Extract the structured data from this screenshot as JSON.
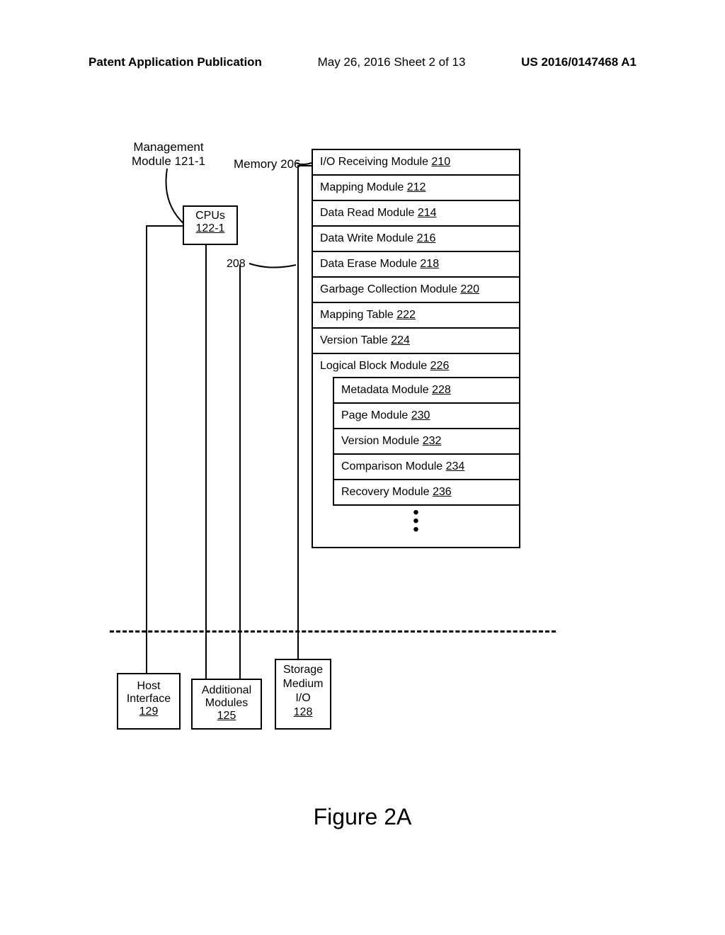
{
  "header": {
    "left": "Patent Application Publication",
    "center": "May 26, 2016  Sheet 2 of 13",
    "right": "US 2016/0147468 A1"
  },
  "mgmt": {
    "line1": "Management",
    "line2": "Module 121-1"
  },
  "memory_label": "Memory 206",
  "cpus": {
    "label": "CPUs",
    "num": "122-1"
  },
  "label_208": "208",
  "modules": {
    "m1": {
      "text": "I/O Receiving Module ",
      "num": "210"
    },
    "m2": {
      "text": "Mapping Module ",
      "num": "212"
    },
    "m3": {
      "text": "Data Read Module ",
      "num": "214"
    },
    "m4": {
      "text": "Data Write Module ",
      "num": "216"
    },
    "m5": {
      "text": "Data Erase Module ",
      "num": "218"
    },
    "m6": {
      "text": "Garbage Collection Module ",
      "num": "220"
    },
    "m7": {
      "text": "Mapping Table ",
      "num": "222"
    },
    "m8": {
      "text": "Version Table ",
      "num": "224"
    },
    "m9": {
      "text": "Logical Block Module ",
      "num": "226"
    },
    "s1": {
      "text": "Metadata Module ",
      "num": "228"
    },
    "s2": {
      "text": "Page Module ",
      "num": "230"
    },
    "s3": {
      "text": "Version Module ",
      "num": "232"
    },
    "s4": {
      "text": "Comparison Module ",
      "num": "234"
    },
    "s5": {
      "text": "Recovery Module ",
      "num": "236"
    }
  },
  "host": {
    "l1": "Host",
    "l2": "Interface",
    "num": "129"
  },
  "addl": {
    "l1": "Additional",
    "l2": "Modules",
    "num": "125"
  },
  "storage": {
    "l1": "Storage",
    "l2": "Medium",
    "l3": "I/O",
    "num": "128"
  },
  "figure": "Figure 2A"
}
